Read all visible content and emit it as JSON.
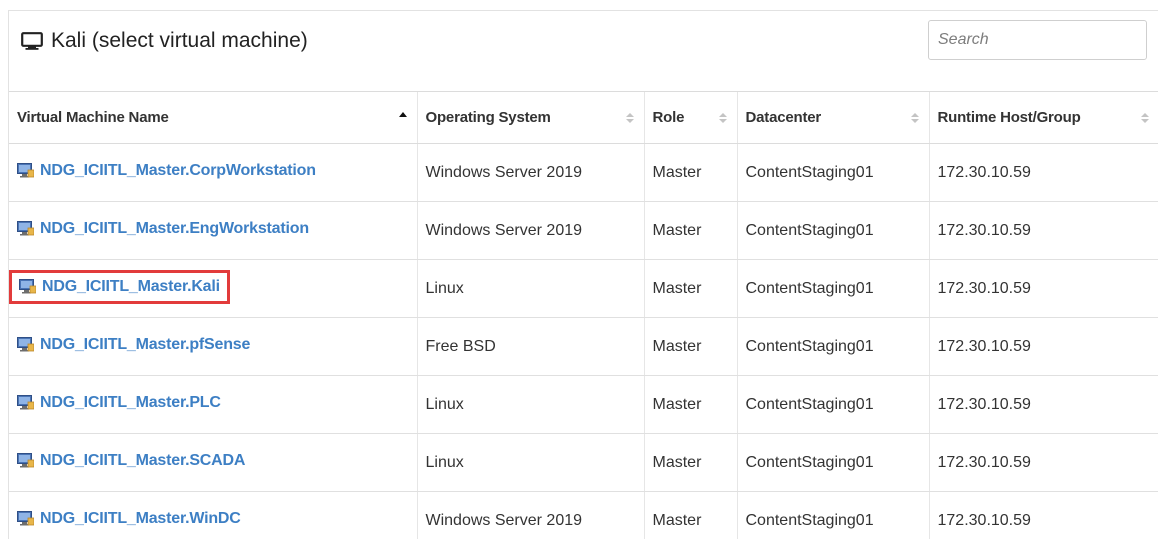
{
  "header": {
    "title": "Kali (select virtual machine)",
    "title_icon": "monitor-icon",
    "search_placeholder": "Search"
  },
  "table": {
    "columns": [
      {
        "label": "Virtual Machine Name",
        "sort": "ascending"
      },
      {
        "label": "Operating System",
        "sort": "none"
      },
      {
        "label": "Role",
        "sort": "none"
      },
      {
        "label": "Datacenter",
        "sort": "none"
      },
      {
        "label": "Runtime Host/Group",
        "sort": "none"
      }
    ],
    "rows": [
      {
        "name": "NDG_ICIITL_Master.CorpWorkstation",
        "os": "Windows Server 2019",
        "role": "Master",
        "datacenter": "ContentStaging01",
        "host": "172.30.10.59"
      },
      {
        "name": "NDG_ICIITL_Master.EngWorkstation",
        "os": "Windows Server 2019",
        "role": "Master",
        "datacenter": "ContentStaging01",
        "host": "172.30.10.59"
      },
      {
        "name": "NDG_ICIITL_Master.Kali",
        "os": "Linux",
        "role": "Master",
        "datacenter": "ContentStaging01",
        "host": "172.30.10.59",
        "highlighted": true
      },
      {
        "name": "NDG_ICIITL_Master.pfSense",
        "os": "Free BSD",
        "role": "Master",
        "datacenter": "ContentStaging01",
        "host": "172.30.10.59"
      },
      {
        "name": "NDG_ICIITL_Master.PLC",
        "os": "Linux",
        "role": "Master",
        "datacenter": "ContentStaging01",
        "host": "172.30.10.59"
      },
      {
        "name": "NDG_ICIITL_Master.SCADA",
        "os": "Linux",
        "role": "Master",
        "datacenter": "ContentStaging01",
        "host": "172.30.10.59"
      },
      {
        "name": "NDG_ICIITL_Master.WinDC",
        "os": "Windows Server 2019",
        "role": "Master",
        "datacenter": "ContentStaging01",
        "host": "172.30.10.59"
      }
    ]
  },
  "colors": {
    "link": "#3d7fc4",
    "highlight_border": "#e23b3b"
  },
  "icons": {
    "vm": "vm-icon",
    "sort_both": "sort-icon",
    "sort_asc": "sort-ascending-icon"
  }
}
